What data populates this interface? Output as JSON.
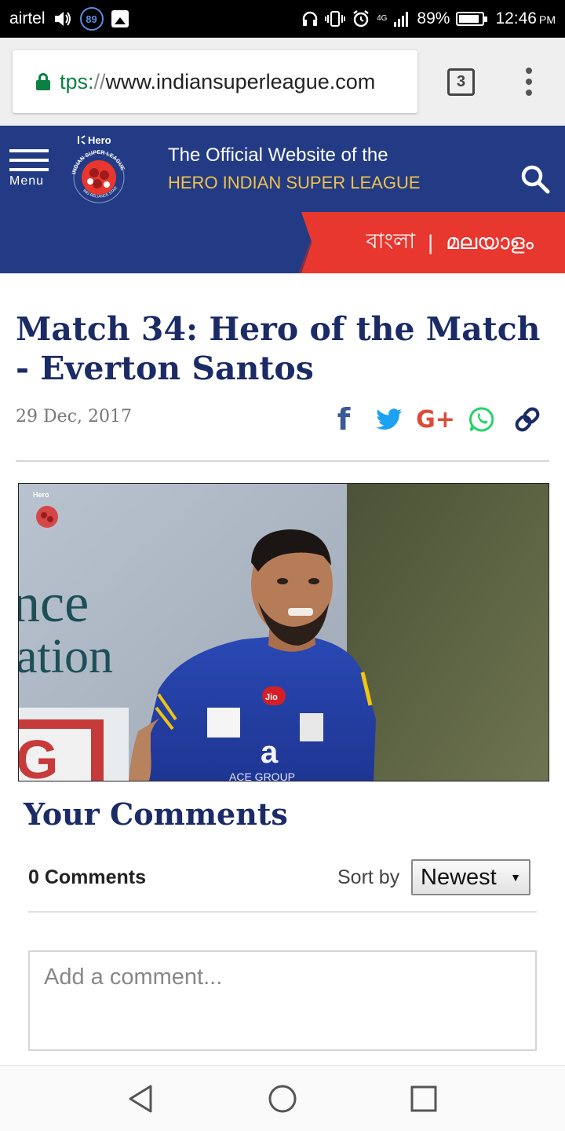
{
  "status_bar": {
    "carrier": "airtel",
    "notification_badge": "89",
    "network": "4G",
    "battery": "89%",
    "battery_level": 0.89,
    "time": "12:46",
    "ampm": "PM"
  },
  "browser": {
    "url_scheme": "tps:",
    "url_sep": "//",
    "url_host": "www.indiansuperleague.com",
    "tab_count": "3"
  },
  "header": {
    "menu_label": "Menu",
    "tagline_line1": "The Official Website of the",
    "tagline_line2": "HERO INDIAN SUPER LEAGUE",
    "logo_brand": "Hero",
    "logo_text": "INDIAN SUPER LEAGUE",
    "logo_sub": "IMG RELIANCE STAR"
  },
  "languages": {
    "bengali": "বাংলা",
    "separator": "|",
    "malayalam": "മലയാളം"
  },
  "article": {
    "title": "Match 34: Hero of the Match - Everton Santos",
    "date": "29 Dec, 2017",
    "image_sign_1": "nce",
    "image_sign_2": "ation",
    "image_sign_3": "G",
    "jersey_sponsor": "Jio",
    "jersey_number": "a",
    "jersey_group": "ACE GROUP"
  },
  "share": {
    "facebook": "f",
    "google_plus": "G+"
  },
  "comments": {
    "heading": "Your Comments",
    "count": "0 Comments",
    "sort_label": "Sort by",
    "sort_value": "Newest",
    "placeholder": "Add a comment..."
  },
  "colors": {
    "brand_navy": "#233b84",
    "title_navy": "#1b2b66",
    "accent_red": "#e8372f",
    "tagline_gold": "#f0c24a",
    "facebook": "#3b5998",
    "twitter": "#1da1f2",
    "google": "#dd4b39",
    "whatsapp": "#25d366",
    "link": "#1b2b66"
  }
}
